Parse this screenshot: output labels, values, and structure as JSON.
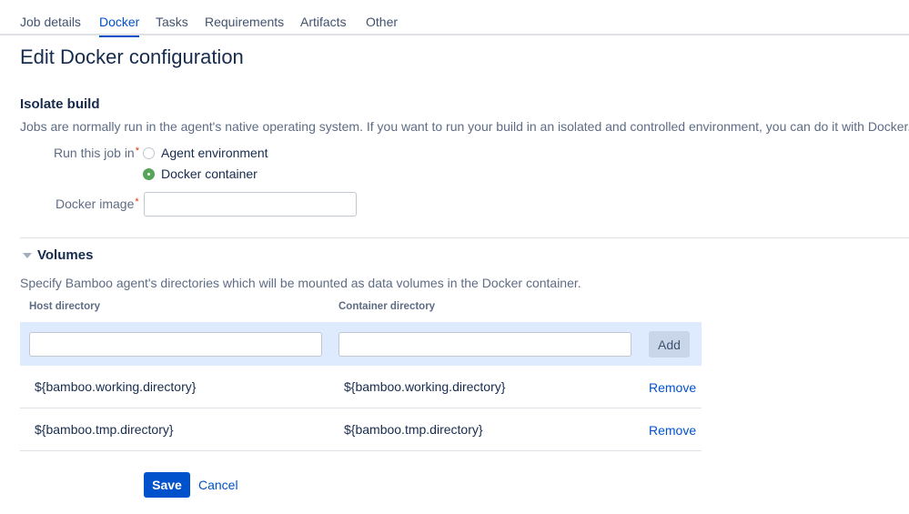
{
  "tabs": [
    {
      "label": "Job details",
      "active": false
    },
    {
      "label": "Docker",
      "active": true
    },
    {
      "label": "Tasks",
      "active": false
    },
    {
      "label": "Requirements",
      "active": false
    },
    {
      "label": "Artifacts",
      "active": false
    },
    {
      "label": "Other",
      "active": false
    }
  ],
  "page_title": "Edit Docker configuration",
  "isolate": {
    "heading": "Isolate build",
    "description": "Jobs are normally run in the agent's native operating system. If you want to run your build in an isolated and controlled environment, you can do it with Docker.",
    "run_label": "Run this job in",
    "required_mark": "*",
    "options": [
      {
        "label": "Agent environment",
        "selected": false
      },
      {
        "label": "Docker container",
        "selected": true
      }
    ],
    "image_label": "Docker image",
    "image_value": ""
  },
  "volumes": {
    "heading": "Volumes",
    "description": "Specify Bamboo agent's directories which will be mounted as data volumes in the Docker container.",
    "col_host": "Host directory",
    "col_container": "Container directory",
    "host_input_value": "",
    "container_input_value": "",
    "add_label": "Add",
    "rows": [
      {
        "host": "${bamboo.working.directory}",
        "container": "${bamboo.working.directory}",
        "action": "Remove"
      },
      {
        "host": "${bamboo.tmp.directory}",
        "container": "${bamboo.tmp.directory}",
        "action": "Remove"
      }
    ]
  },
  "actions": {
    "save": "Save",
    "cancel": "Cancel"
  },
  "colors": {
    "accent": "#0052cc",
    "selected_radio": "#57a55a",
    "add_row_bg": "#deebff",
    "required": "#de350b"
  }
}
